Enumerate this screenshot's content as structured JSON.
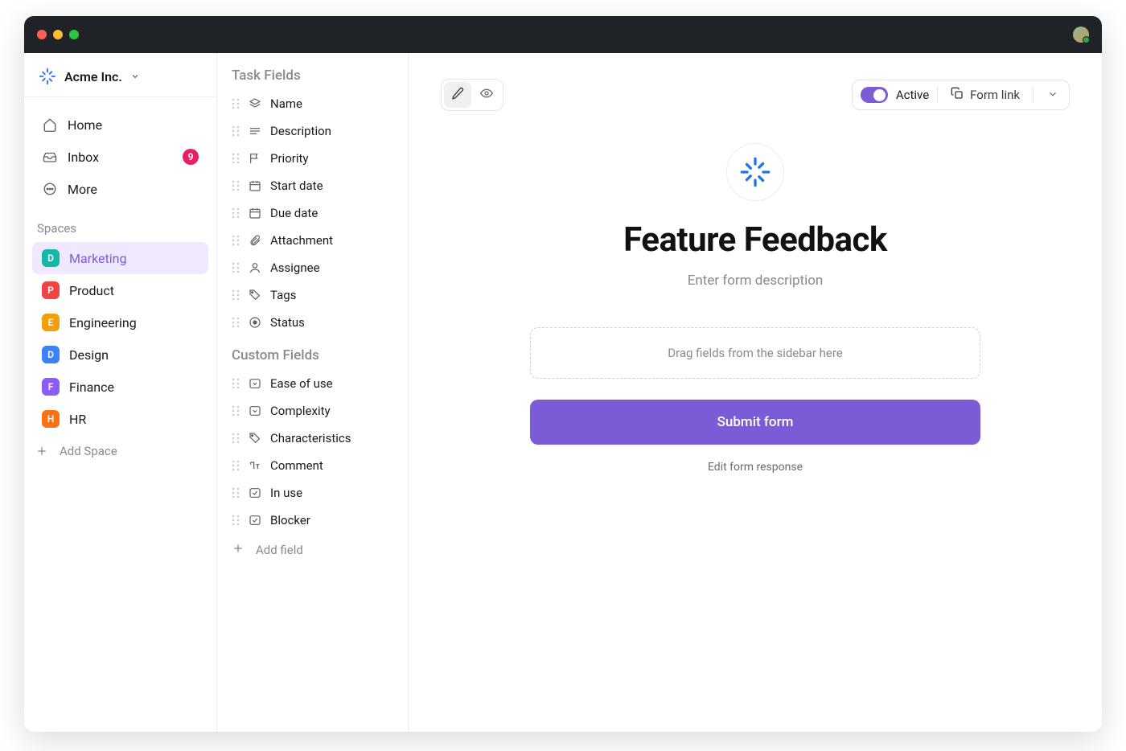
{
  "workspace": {
    "name": "Acme Inc."
  },
  "nav": {
    "items": [
      {
        "label": "Home",
        "icon": "home"
      },
      {
        "label": "Inbox",
        "icon": "inbox",
        "badge": "9"
      },
      {
        "label": "More",
        "icon": "dots"
      }
    ],
    "spaces_label": "Spaces",
    "spaces": [
      {
        "label": "Marketing",
        "letter": "D",
        "color": "#14b8a6",
        "active": true
      },
      {
        "label": "Product",
        "letter": "P",
        "color": "#ef4444"
      },
      {
        "label": "Engineering",
        "letter": "E",
        "color": "#f59e0b"
      },
      {
        "label": "Design",
        "letter": "D",
        "color": "#3b82f6"
      },
      {
        "label": "Finance",
        "letter": "F",
        "color": "#8b5cf6"
      },
      {
        "label": "HR",
        "letter": "H",
        "color": "#f97316"
      }
    ],
    "add_space": "Add Space"
  },
  "fields_panel": {
    "task_heading": "Task Fields",
    "task_fields": [
      {
        "label": "Name",
        "icon": "layers"
      },
      {
        "label": "Description",
        "icon": "lines"
      },
      {
        "label": "Priority",
        "icon": "flag"
      },
      {
        "label": "Start date",
        "icon": "calendar"
      },
      {
        "label": "Due date",
        "icon": "calendar"
      },
      {
        "label": "Attachment",
        "icon": "paperclip"
      },
      {
        "label": "Assignee",
        "icon": "user"
      },
      {
        "label": "Tags",
        "icon": "tag"
      },
      {
        "label": "Status",
        "icon": "target"
      }
    ],
    "custom_heading": "Custom Fields",
    "custom_fields": [
      {
        "label": "Ease of use",
        "icon": "dropdown"
      },
      {
        "label": "Complexity",
        "icon": "dropdown"
      },
      {
        "label": "Characteristics",
        "icon": "tag"
      },
      {
        "label": "Comment",
        "icon": "text"
      },
      {
        "label": "In use",
        "icon": "checkbox"
      },
      {
        "label": "Blocker",
        "icon": "checkbox"
      }
    ],
    "add_field": "Add field"
  },
  "toolbar": {
    "active_label": "Active",
    "form_link_label": "Form link"
  },
  "form": {
    "title": "Feature Feedback",
    "description_placeholder": "Enter form description",
    "dropzone": "Drag fields from the sidebar here",
    "submit": "Submit form",
    "footer": "Edit form response"
  }
}
